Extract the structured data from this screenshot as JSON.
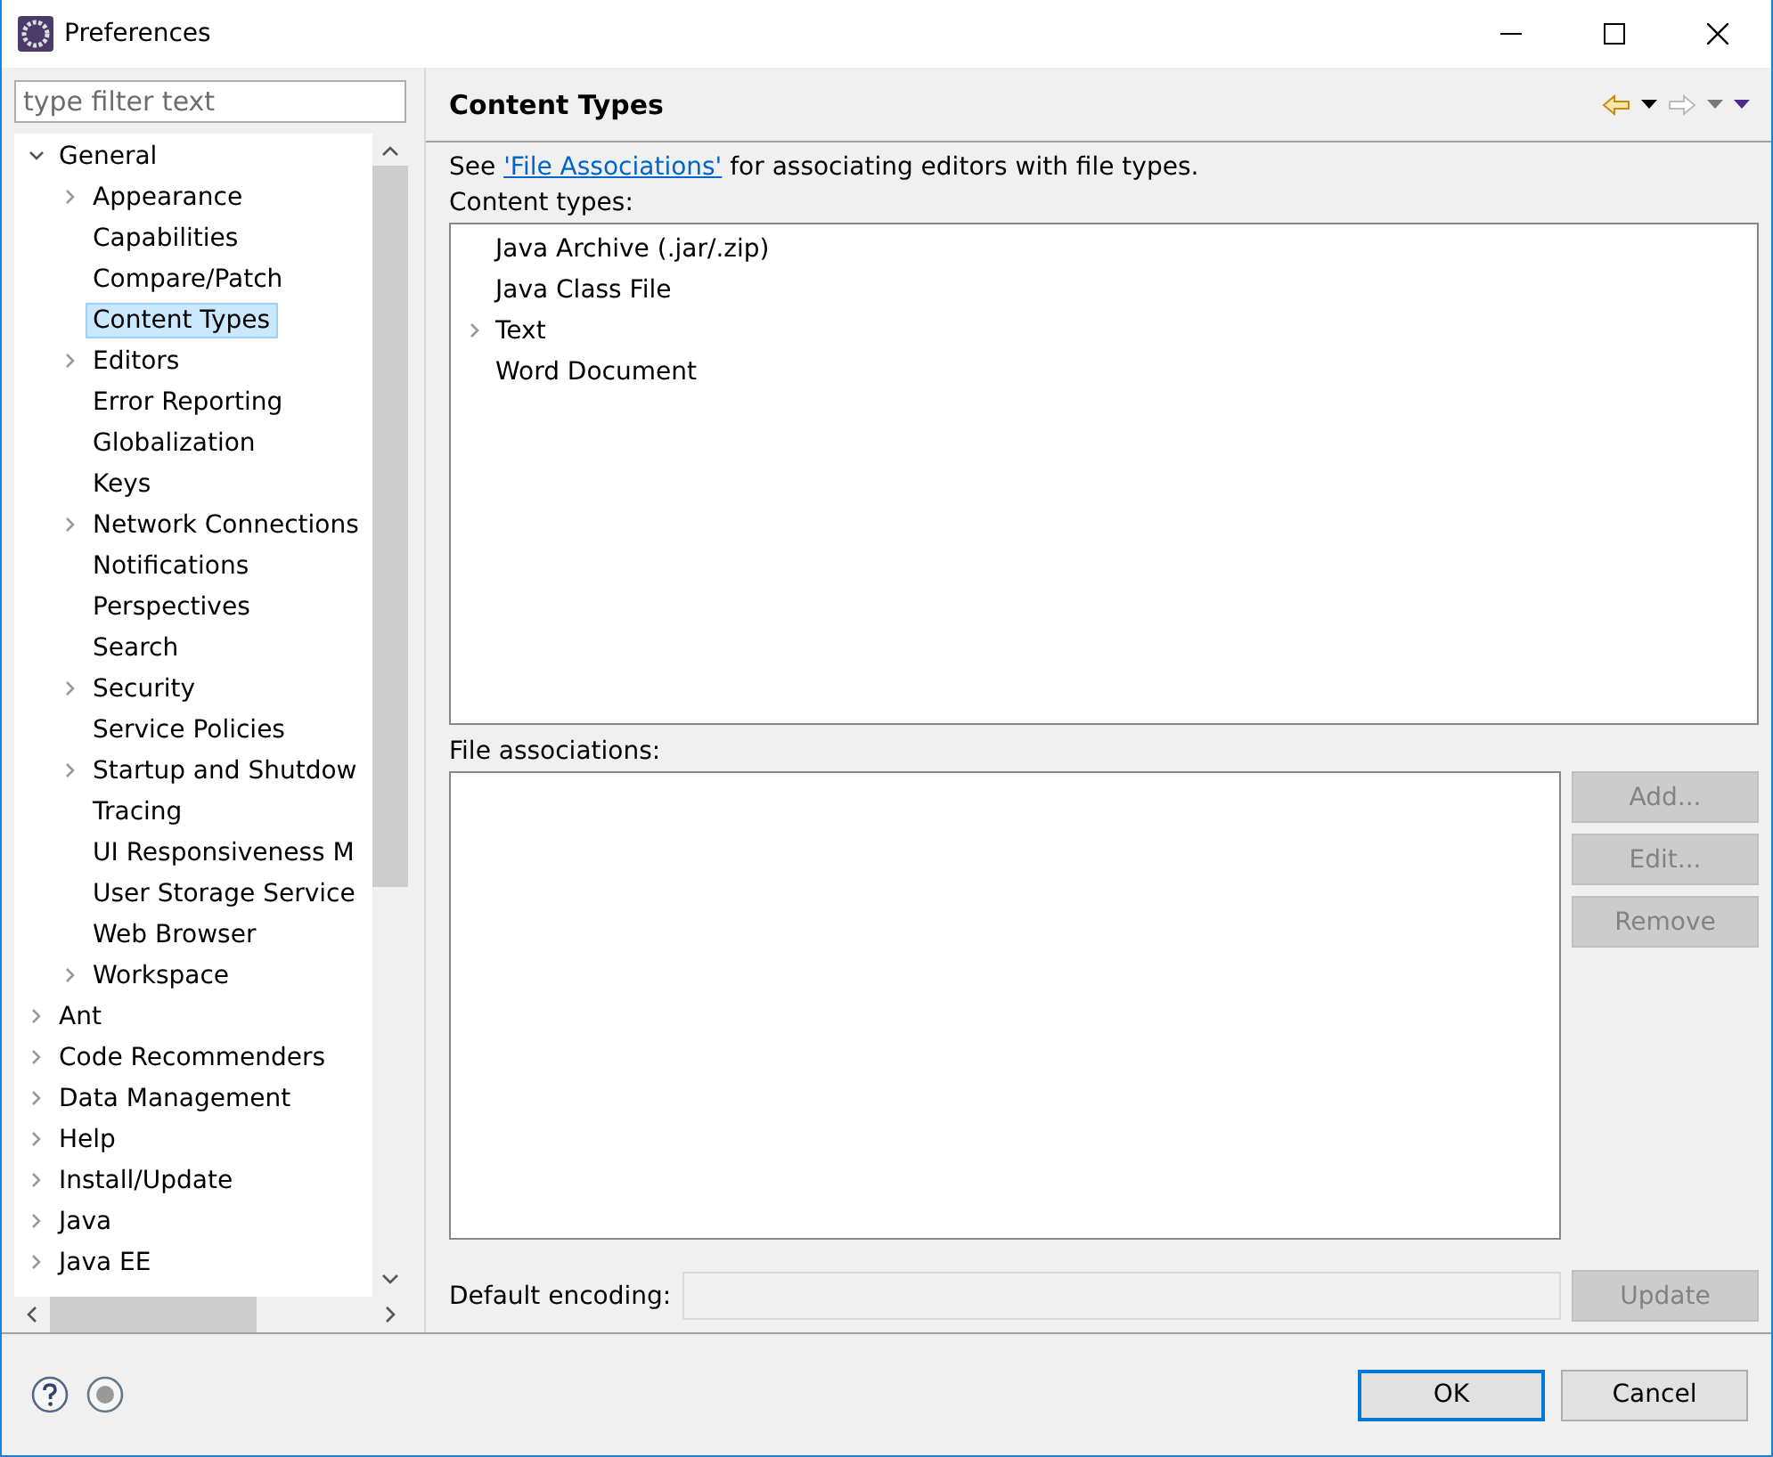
{
  "window": {
    "title": "Preferences"
  },
  "filter": {
    "placeholder": "type filter text"
  },
  "tree": [
    {
      "label": "General",
      "expanded": true,
      "selected": false,
      "children": [
        {
          "label": "Appearance",
          "expanded": false,
          "selected": false
        },
        {
          "label": "Capabilities",
          "selected": false
        },
        {
          "label": "Compare/Patch",
          "selected": false
        },
        {
          "label": "Content Types",
          "selected": true
        },
        {
          "label": "Editors",
          "expanded": false,
          "selected": false
        },
        {
          "label": "Error Reporting",
          "selected": false
        },
        {
          "label": "Globalization",
          "selected": false
        },
        {
          "label": "Keys",
          "selected": false
        },
        {
          "label": "Network Connections",
          "expanded": false,
          "selected": false
        },
        {
          "label": "Notifications",
          "selected": false
        },
        {
          "label": "Perspectives",
          "selected": false
        },
        {
          "label": "Search",
          "selected": false
        },
        {
          "label": "Security",
          "expanded": false,
          "selected": false
        },
        {
          "label": "Service Policies",
          "selected": false
        },
        {
          "label": "Startup and Shutdow",
          "expanded": false,
          "selected": false
        },
        {
          "label": "Tracing",
          "selected": false
        },
        {
          "label": "UI Responsiveness M",
          "selected": false
        },
        {
          "label": "User Storage Service",
          "selected": false
        },
        {
          "label": "Web Browser",
          "selected": false
        },
        {
          "label": "Workspace",
          "expanded": false,
          "selected": false
        }
      ]
    },
    {
      "label": "Ant",
      "expanded": false,
      "selected": false
    },
    {
      "label": "Code Recommenders",
      "expanded": false,
      "selected": false
    },
    {
      "label": "Data Management",
      "expanded": false,
      "selected": false
    },
    {
      "label": "Help",
      "expanded": false,
      "selected": false
    },
    {
      "label": "Install/Update",
      "expanded": false,
      "selected": false
    },
    {
      "label": "Java",
      "expanded": false,
      "selected": false
    },
    {
      "label": "Java EE",
      "expanded": false,
      "selected": false
    }
  ],
  "page": {
    "title": "Content Types",
    "intro_before": "See ",
    "intro_link": "'File Associations'",
    "intro_after": " for associating editors with file types.",
    "content_types_label": "Content types:",
    "content_types": [
      {
        "label": "Java Archive (.jar/.zip)"
      },
      {
        "label": "Java Class File"
      },
      {
        "label": "Text",
        "expanded": false
      },
      {
        "label": "Word Document"
      }
    ],
    "file_associations_label": "File associations:",
    "side_buttons": [
      {
        "label": "Add...",
        "disabled": true
      },
      {
        "label": "Edit...",
        "disabled": true
      },
      {
        "label": "Remove",
        "disabled": true
      }
    ],
    "encoding_label": "Default encoding:",
    "update_button": {
      "label": "Update",
      "disabled": true
    }
  },
  "buttons": [
    {
      "label": "OK",
      "default": true
    },
    {
      "label": "Cancel",
      "default": false
    }
  ]
}
